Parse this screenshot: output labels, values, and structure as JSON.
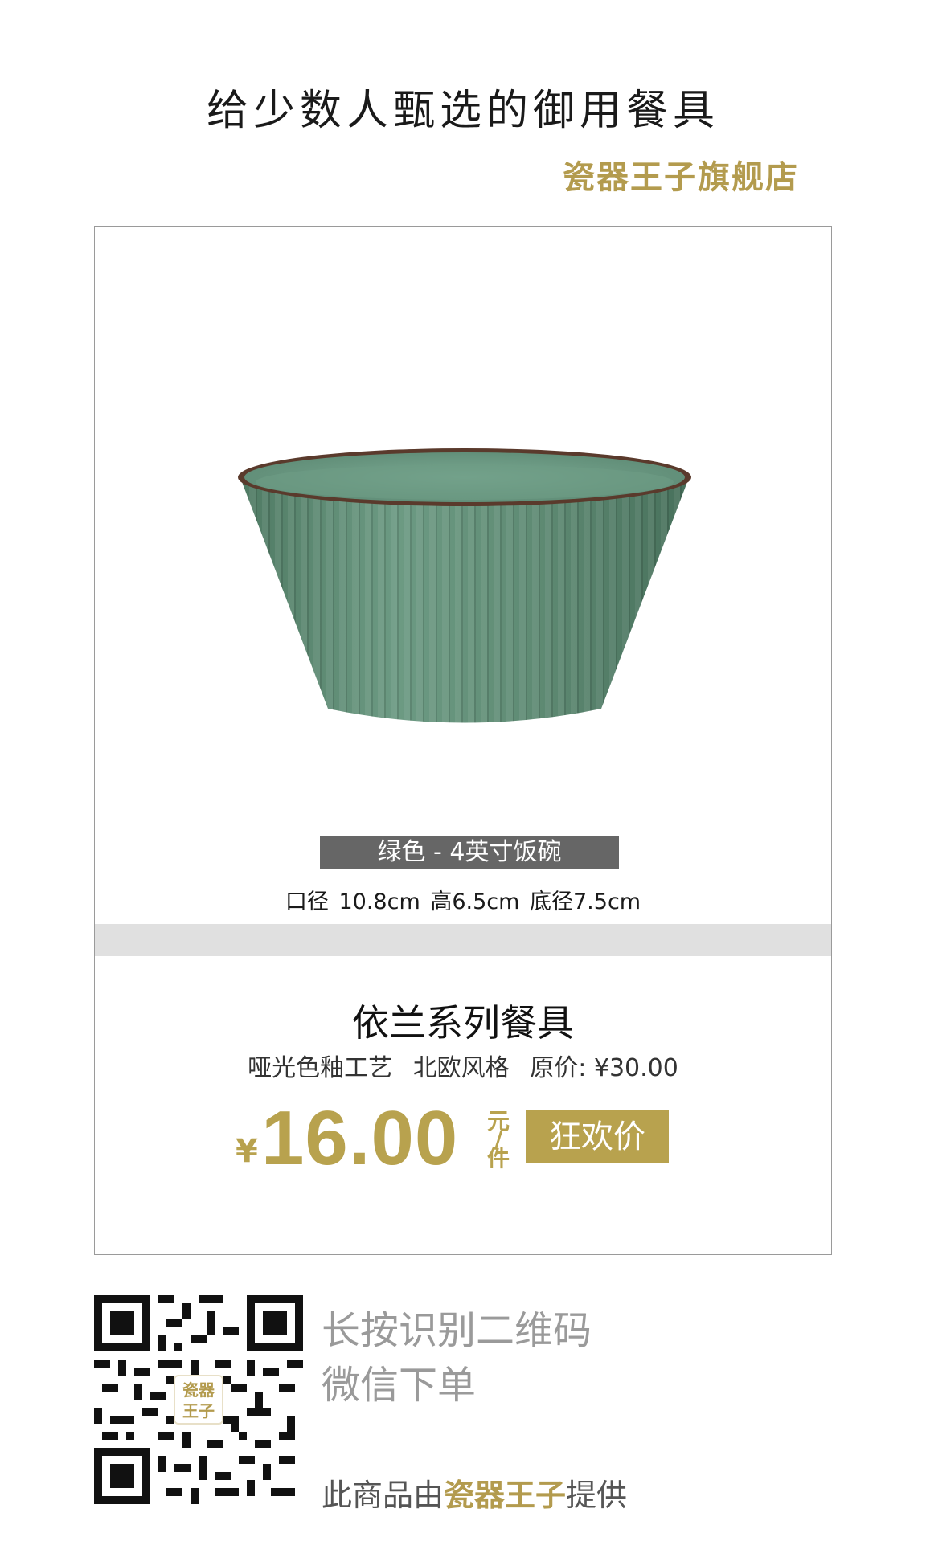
{
  "header": {
    "headline": "给少数人甄选的御用餐具",
    "store_name": "瓷器王子旗舰店"
  },
  "product": {
    "variant": "绿色 - 4英寸饭碗",
    "dimensions": "口径 10.8cm  高6.5cm  底径7.5cm",
    "series": "依兰系列餐具",
    "features": [
      "哑光色釉工艺",
      "北欧风格",
      "原价: ¥30.00"
    ],
    "currency_symbol": "¥",
    "price": "16.00",
    "unit_top": "元",
    "unit_sep": "/",
    "unit_bottom": "件",
    "promo_badge": "狂欢价",
    "bowl_color": "#5f8a72"
  },
  "footer": {
    "scan_line1": "长按识别二维码",
    "scan_line2": "微信下单",
    "provided_prefix": "此商品由",
    "provided_brand": "瓷器王子",
    "provided_suffix": "提供",
    "qr_logo_line1": "瓷器",
    "qr_logo_line2": "王子"
  },
  "colors": {
    "gold": "#b8a24e",
    "variant_bar": "#666666",
    "band": "#e0e0e0"
  }
}
